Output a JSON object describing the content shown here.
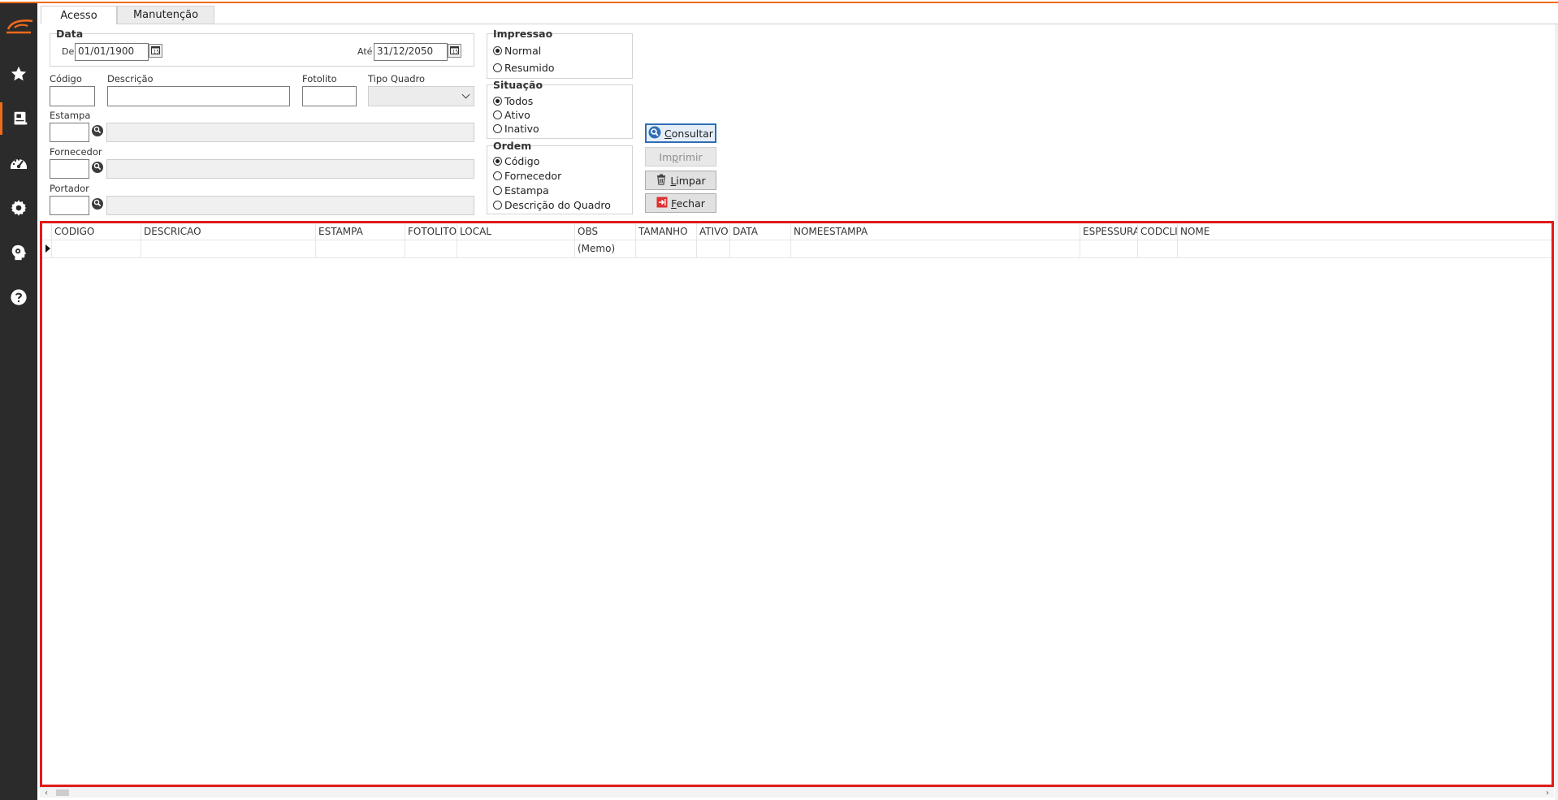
{
  "sidebar": {
    "logo": "company-logo",
    "items": [
      {
        "icon": "star-icon"
      },
      {
        "icon": "book-icon",
        "active": true
      },
      {
        "icon": "dashboard-gauge-icon"
      },
      {
        "icon": "gear-icon"
      },
      {
        "icon": "head-gear-icon"
      },
      {
        "icon": "help-icon"
      }
    ]
  },
  "tabs": [
    {
      "label": "Acesso",
      "active": true
    },
    {
      "label": "Manutenção",
      "active": false
    }
  ],
  "data_group": {
    "title": "Data",
    "from_label": "De",
    "from_value": "01/01/1900",
    "to_label": "Até",
    "to_value": "31/12/2050"
  },
  "fields": {
    "codigo_label": "Código",
    "codigo_value": "",
    "descricao_label": "Descrição",
    "descricao_value": "",
    "fotolito_label": "Fotolito",
    "fotolito_value": "",
    "tipo_quadro_label": "Tipo Quadro",
    "tipo_quadro_value": "",
    "estampa_label": "Estampa",
    "estampa_value": "",
    "fornecedor_label": "Fornecedor",
    "fornecedor_value": "",
    "portador_label": "Portador",
    "portador_value": ""
  },
  "impressao": {
    "title": "Impressao",
    "options": [
      "Normal",
      "Resumido"
    ],
    "selected": "Normal"
  },
  "situacao": {
    "title": "Situação",
    "options": [
      "Todos",
      "Ativo",
      "Inativo"
    ],
    "selected": "Todos"
  },
  "ordem": {
    "title": "Ordem",
    "options": [
      "Código",
      "Fornecedor",
      "Estampa",
      "Descrição do Quadro"
    ],
    "selected": "Código"
  },
  "buttons": {
    "consultar": {
      "pre": "",
      "key": "C",
      "post": "onsultar"
    },
    "imprimir": {
      "pre": "Im",
      "key": "p",
      "post": "rimir"
    },
    "limpar": {
      "pre": "",
      "key": "L",
      "post": "impar"
    },
    "fechar": {
      "pre": "",
      "key": "F",
      "post": "echar"
    }
  },
  "colors": {
    "accent": "#f06a1d",
    "sidebar_bg": "#2b2b2b",
    "grid_border": "#e01b1b",
    "primary_button_border": "#2f6fb5"
  },
  "grid": {
    "columns": [
      "CODIGO",
      "DESCRICAO",
      "ESTAMPA",
      "FOTOLITO",
      "LOCAL",
      "OBS",
      "TAMANHO",
      "ATIVO",
      "DATA",
      "NOMEESTAMPA",
      "ESPESSURA",
      "CODCLI",
      "NOME"
    ],
    "rows": [
      [
        "",
        "",
        "",
        "",
        "",
        "(Memo)",
        "",
        "",
        "",
        "",
        "",
        "",
        ""
      ]
    ]
  }
}
